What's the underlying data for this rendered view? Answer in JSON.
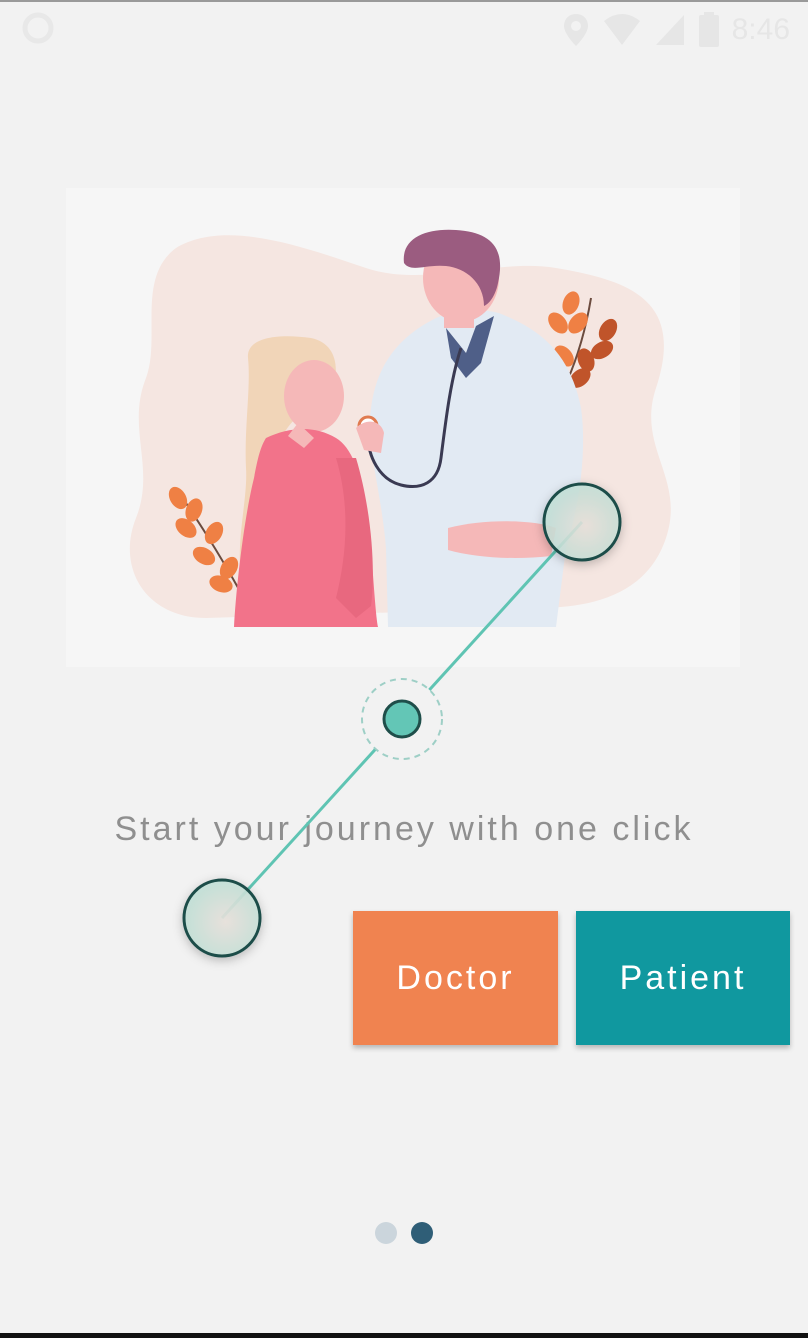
{
  "status_bar": {
    "time": "8:46",
    "icons": [
      "circle-icon",
      "location-icon",
      "wifi-icon",
      "signal-icon",
      "battery-icon"
    ]
  },
  "illustration": {
    "description_icon": "doctor-patient-illustration"
  },
  "tagline": "Start your journey with one click",
  "buttons": {
    "doctor_label": "Doctor",
    "patient_label": "Patient"
  },
  "page_indicator": {
    "total": 2,
    "active_index": 1
  },
  "colors": {
    "doctor": "#f08350",
    "patient": "#10989f",
    "accent_teal": "#5fc4b3",
    "indicator_active": "#2f5e77",
    "indicator_inactive": "#cbd5dc"
  }
}
